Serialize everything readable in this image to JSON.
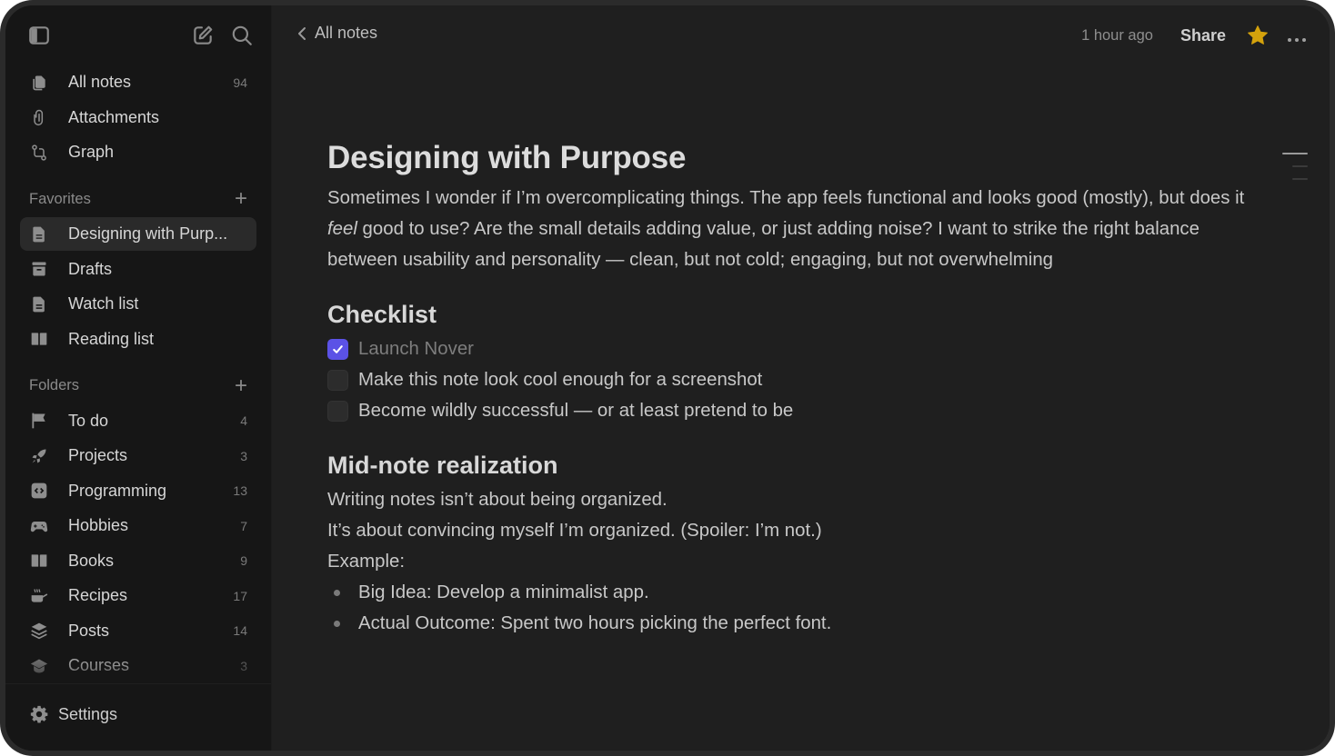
{
  "sidebar": {
    "top_icons": [
      "sidebar-toggle-icon",
      "compose-icon",
      "search-icon"
    ],
    "primary": [
      {
        "label": "All notes",
        "count": "94",
        "icon": "notes-stack-icon"
      },
      {
        "label": "Attachments",
        "count": "",
        "icon": "paperclip-icon"
      },
      {
        "label": "Graph",
        "count": "",
        "icon": "graph-icon"
      }
    ],
    "favorites_title": "Favorites",
    "favorites": [
      {
        "label": "Designing with Purp...",
        "icon": "document-icon",
        "active": true
      },
      {
        "label": "Drafts",
        "icon": "archive-icon"
      },
      {
        "label": "Watch list",
        "icon": "document-icon"
      },
      {
        "label": "Reading list",
        "icon": "book-icon"
      }
    ],
    "folders_title": "Folders",
    "folders": [
      {
        "label": "To do",
        "count": "4",
        "icon": "flag-icon"
      },
      {
        "label": "Projects",
        "count": "3",
        "icon": "rocket-icon"
      },
      {
        "label": "Programming",
        "count": "13",
        "icon": "code-icon"
      },
      {
        "label": "Hobbies",
        "count": "7",
        "icon": "gamepad-icon"
      },
      {
        "label": "Books",
        "count": "9",
        "icon": "book-icon"
      },
      {
        "label": "Recipes",
        "count": "17",
        "icon": "cooking-pot-icon"
      },
      {
        "label": "Posts",
        "count": "14",
        "icon": "layers-icon"
      },
      {
        "label": "Courses",
        "count": "3",
        "icon": "graduation-cap-icon"
      }
    ],
    "settings_label": "Settings"
  },
  "topbar": {
    "back_label": "All notes",
    "timestamp": "1 hour ago",
    "share_label": "Share",
    "starred": true,
    "star_color": "#d4a20c"
  },
  "note": {
    "title": "Designing with Purpose",
    "intro_before_em": "Sometimes I wonder if I’m overcomplicating things. The app feels functional and looks good (mostly), but does it ",
    "intro_em": "feel",
    "intro_after_em": " good to use? Are the small details adding value, or just adding noise? I want to strike the right balance between usability and personality — clean, but not cold; engaging, but not overwhelming",
    "checklist_heading": "Checklist",
    "checklist": [
      {
        "text": "Launch Nover",
        "checked": true
      },
      {
        "text": "Make this note look cool enough for a screenshot",
        "checked": false
      },
      {
        "text": "Become wildly successful — or at least pretend to be",
        "checked": false
      }
    ],
    "realization_heading": "Mid-note realization",
    "realization_lines": [
      "Writing notes isn’t about being organized.",
      "It’s about convincing myself I’m organized. (Spoiler: I’m not.)",
      "Example:"
    ],
    "bullets": [
      "Big Idea: Develop a minimalist app.",
      "Actual Outcome: Spent two hours picking the perfect font."
    ]
  },
  "colors": {
    "accent": "#5b52e6",
    "star": "#d4a20c",
    "sidebar_bg": "#161616",
    "main_bg": "#1f1f1f"
  }
}
